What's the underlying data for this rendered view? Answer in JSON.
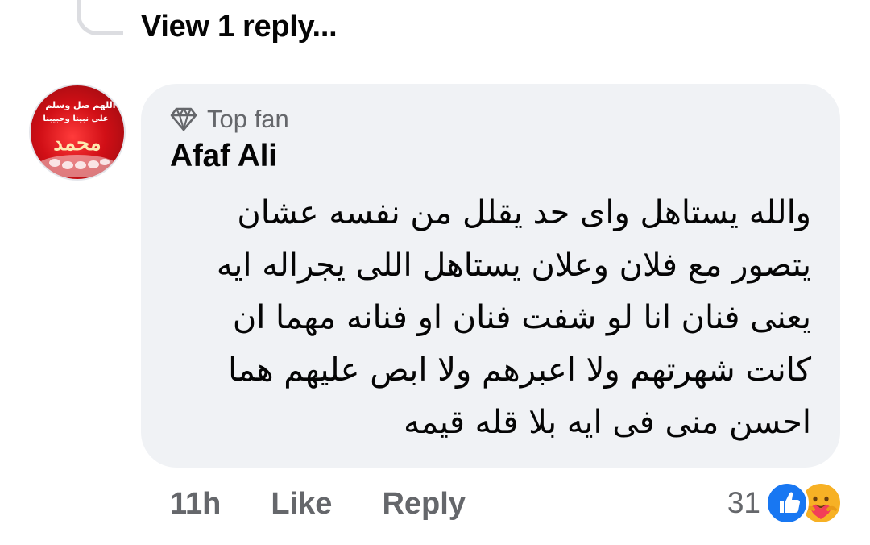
{
  "thread": {
    "view_replies_label": "View 1 reply..."
  },
  "comment": {
    "badge_label": "Top fan",
    "badge_icon": "diamond-icon",
    "author": "Afaf Ali",
    "avatar_text": [
      "اللهم صل وسلم",
      "على نبينا وحبيبنا",
      "محمد"
    ],
    "text": "والله يستاهل واى حد يقلل من نفسه عشان\nيتصور مع فلان وعلان يستاهل اللى يجراله ايه\nيعنى فنان  انا لو شفت فنان او فنانه مهما ان\nكانت شهرتهم ولا اعبرهم ولا ابص عليهم هما\nاحسن منى فى ايه بلا قله قيمه"
  },
  "actions": {
    "time": "11h",
    "like_label": "Like",
    "reply_label": "Reply"
  },
  "reactions": {
    "count": "31",
    "types": [
      "like-icon",
      "care-icon"
    ],
    "colors": {
      "like": "#1877f2",
      "care": "#f7b125"
    }
  }
}
